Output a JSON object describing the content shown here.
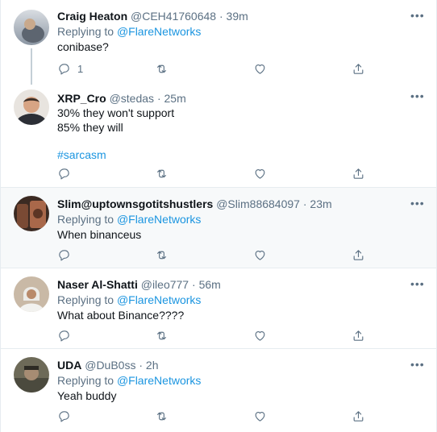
{
  "tweets": [
    {
      "name": "Craig Heaton",
      "handle": "@CEH41760648",
      "time": "39m",
      "replying_prefix": "Replying to",
      "replying_to": "@FlareNetworks",
      "lines": [
        "conibase?"
      ],
      "reply_count": "1"
    },
    {
      "name": "XRP_Cro",
      "handle": "@stedas",
      "time": "25m",
      "lines": [
        "30% they won't support",
        "85% they will"
      ],
      "hashtag": "#sarcasm"
    },
    {
      "name": "Slim@uptownsgotitshustlers",
      "handle": "@Slim88684097",
      "time": "23m",
      "replying_prefix": "Replying to",
      "replying_to": "@FlareNetworks",
      "lines": [
        "When binanceus"
      ]
    },
    {
      "name": "Naser Al-Shatti",
      "handle": "@ileo777",
      "time": "56m",
      "replying_prefix": "Replying to",
      "replying_to": "@FlareNetworks",
      "lines": [
        "What about Binance????"
      ]
    },
    {
      "name": "UDA",
      "handle": "@DuB0ss",
      "time": "2h",
      "replying_prefix": "Replying to",
      "replying_to": "@FlareNetworks",
      "lines": [
        "Yeah buddy"
      ]
    }
  ],
  "separator": "·",
  "more_glyph": "•••",
  "colors": {
    "link": "#1b95e0",
    "muted": "#5b7083",
    "highlight_bg": "#f7f9fa",
    "border": "#e6ecf0"
  },
  "icons": [
    "reply-icon",
    "retweet-icon",
    "like-icon",
    "share-icon",
    "more-icon"
  ]
}
